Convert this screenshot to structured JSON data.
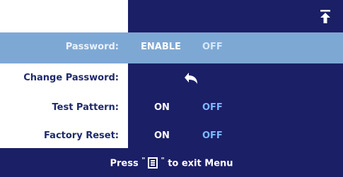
{
  "header": {
    "up_icon": "up-arrow-exit-icon"
  },
  "rows": [
    {
      "label": "Password:",
      "options": [
        "ENABLE",
        "OFF"
      ],
      "selected": "ENABLE",
      "highlighted": true
    },
    {
      "label": "Change Password:",
      "icon": "enter-arrow-icon",
      "highlighted": false
    },
    {
      "label": "Test Pattern:",
      "options": [
        "ON",
        "OFF"
      ],
      "selected": "ON",
      "highlighted": false
    },
    {
      "label": "Factory Reset:",
      "options": [
        "ON",
        "OFF"
      ],
      "selected": "ON",
      "highlighted": false
    }
  ],
  "footer": {
    "prefix": "Press",
    "suffix": "to exit Menu",
    "button_icon": "menu-button-icon"
  },
  "colors": {
    "panel": "#1a1f66",
    "highlight": "#7ea8d4",
    "label": "#1f2a6b",
    "option_on": "#ffffff",
    "option_off": "#7fb8ff"
  }
}
